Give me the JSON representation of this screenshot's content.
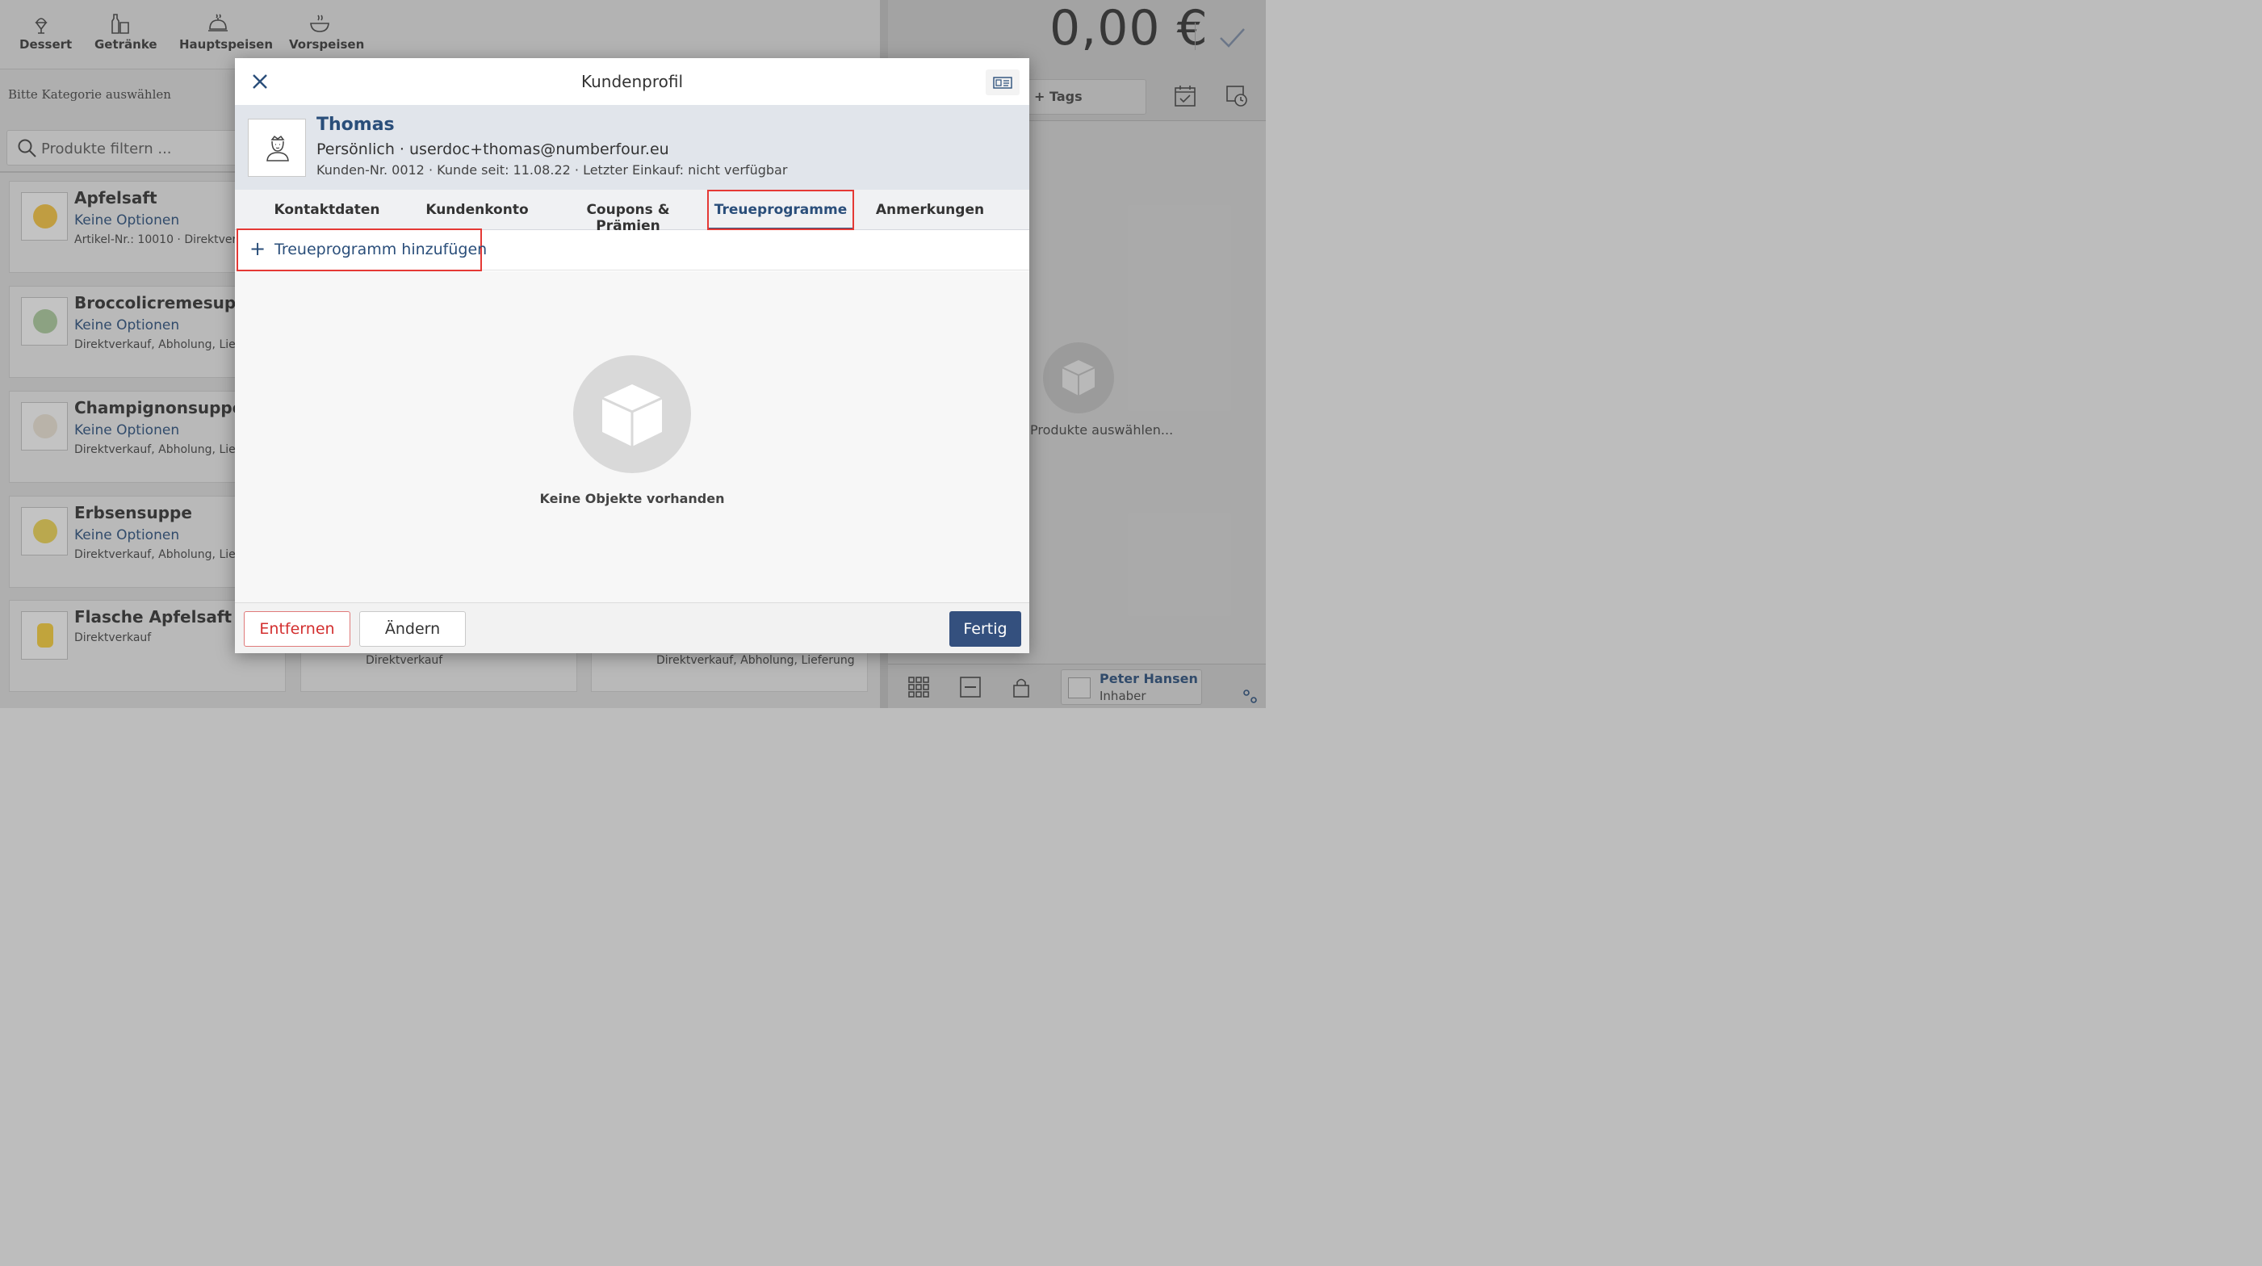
{
  "categories": [
    {
      "label": "Dessert",
      "icon": "dessert-icon"
    },
    {
      "label": "Getränke",
      "icon": "drinks-icon"
    },
    {
      "label": "Hauptspeisen",
      "icon": "cloche-icon"
    },
    {
      "label": "Vorspeisen",
      "icon": "soup-bowl-icon"
    }
  ],
  "sidebar": {
    "hint": "Bitte Kategorie auswählen",
    "filter_placeholder": "Produkte filtern ..."
  },
  "products": [
    {
      "title": "Apfelsaft",
      "option": "Keine Optionen",
      "meta": "Artikel-Nr.: 10010 · Direktver"
    },
    {
      "title": "Broccolicremesuppe",
      "option": "Keine Optionen",
      "meta": "Direktverkauf, Abholung, Lief"
    },
    {
      "title": "Champignonsuppe",
      "option": "Keine Optionen",
      "meta": "Direktverkauf, Abholung, Lief"
    },
    {
      "title": "Erbsensuppe",
      "option": "Keine Optionen",
      "meta": "Direktverkauf, Abholung, Lief"
    },
    {
      "title": "Flasche Apfelsaft",
      "option": "",
      "meta": "Direktverkauf"
    }
  ],
  "products_row2": [
    {
      "meta": "Direktverkauf"
    },
    {
      "meta": "Direktverkauf, Abholung, Lieferung"
    }
  ],
  "cart": {
    "total": "0,00 €",
    "tags_label": "+  Tags",
    "empty_label": "Produkte auswählen..."
  },
  "user": {
    "name": "Peter Hansen",
    "role": "Inhaber"
  },
  "modal": {
    "title": "Kundenprofil",
    "customer": {
      "name": "Thomas",
      "contact": "Persönlich · userdoc+thomas@numberfour.eu",
      "meta": "Kunden-Nr. 0012 · Kunde seit: 11.08.22 · Letzter Einkauf: nicht verfügbar"
    },
    "tabs": [
      {
        "label": "Kontaktdaten"
      },
      {
        "label": "Kundenkonto"
      },
      {
        "label": "Coupons & Prämien"
      },
      {
        "label": "Treueprogramme"
      },
      {
        "label": "Anmerkungen"
      }
    ],
    "active_tab": "Treueprogramme",
    "add_label": "Treueprogramm hinzufügen",
    "empty_label": "Keine Objekte vorhanden",
    "buttons": {
      "remove": "Entfernen",
      "edit": "Ändern",
      "done": "Fertig"
    }
  },
  "colors": {
    "accent": "#2a4e7a",
    "highlight": "#e53935",
    "primary_button": "#34507e"
  }
}
